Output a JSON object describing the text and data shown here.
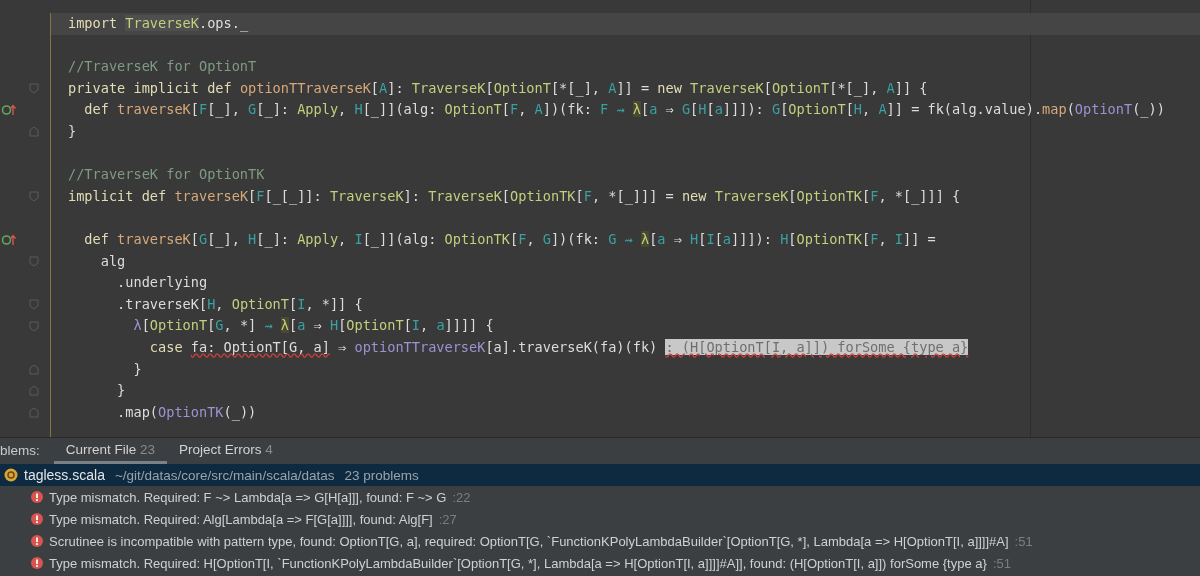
{
  "editor": {
    "lines": [
      {
        "kind": "current",
        "overrides": false,
        "fold_open": false,
        "fold_close": false,
        "tokens": [
          {
            "kind": "kw",
            "text": "import "
          },
          {
            "kind": "type_hl",
            "text": "TraverseK"
          },
          {
            "kind": "plain",
            "text": ".ops._"
          }
        ]
      },
      {
        "kind": "blank",
        "overrides": false,
        "fold_open": false,
        "fold_close": false
      },
      {
        "kind": "code",
        "overrides": false,
        "fold_open": false,
        "fold_close": false,
        "tokens": [
          {
            "kind": "comment",
            "text": "//TraverseK for OptionT"
          }
        ]
      },
      {
        "kind": "code",
        "overrides": false,
        "fold_open": true,
        "fold_close": false,
        "tokens": [
          {
            "kind": "kw",
            "text": "private implicit def "
          },
          {
            "kind": "fn",
            "text": "optionTTraverseK"
          },
          {
            "kind": "plain",
            "text": "["
          },
          {
            "kind": "tp",
            "text": "A"
          },
          {
            "kind": "plain",
            "text": "]: "
          },
          {
            "kind": "type",
            "text": "TraverseK"
          },
          {
            "kind": "plain",
            "text": "["
          },
          {
            "kind": "type",
            "text": "OptionT"
          },
          {
            "kind": "plain",
            "text": "[*[_], "
          },
          {
            "kind": "tp",
            "text": "A"
          },
          {
            "kind": "plain",
            "text": "]] = "
          },
          {
            "kind": "kw",
            "text": "new "
          },
          {
            "kind": "type",
            "text": "TraverseK"
          },
          {
            "kind": "plain",
            "text": "["
          },
          {
            "kind": "type",
            "text": "OptionT"
          },
          {
            "kind": "plain",
            "text": "[*[_], "
          },
          {
            "kind": "tp",
            "text": "A"
          },
          {
            "kind": "plain",
            "text": "]] {"
          }
        ]
      },
      {
        "kind": "code",
        "overrides": true,
        "fold_open": false,
        "fold_close": false,
        "tokens": [
          {
            "kind": "kw",
            "text": "  def "
          },
          {
            "kind": "fn",
            "text": "traverseK"
          },
          {
            "kind": "plain",
            "text": "["
          },
          {
            "kind": "tp",
            "text": "F"
          },
          {
            "kind": "plain",
            "text": "[_], "
          },
          {
            "kind": "tp",
            "text": "G"
          },
          {
            "kind": "plain",
            "text": "[_]: "
          },
          {
            "kind": "type",
            "text": "Apply"
          },
          {
            "kind": "plain",
            "text": ", "
          },
          {
            "kind": "tp",
            "text": "H"
          },
          {
            "kind": "plain",
            "text": "[_]](alg: "
          },
          {
            "kind": "type",
            "text": "OptionT"
          },
          {
            "kind": "plain",
            "text": "["
          },
          {
            "kind": "tp",
            "text": "F"
          },
          {
            "kind": "plain",
            "text": ", "
          },
          {
            "kind": "tp",
            "text": "A"
          },
          {
            "kind": "plain",
            "text": "])(fk: "
          },
          {
            "kind": "tp",
            "text": "F ⇝ "
          },
          {
            "kind": "lam",
            "text": "λ"
          },
          {
            "kind": "plain",
            "text": "["
          },
          {
            "kind": "tp",
            "text": "a"
          },
          {
            "kind": "plain",
            "text": " ⇒ "
          },
          {
            "kind": "tp",
            "text": "G"
          },
          {
            "kind": "plain",
            "text": "["
          },
          {
            "kind": "tp",
            "text": "H"
          },
          {
            "kind": "plain",
            "text": "["
          },
          {
            "kind": "tp",
            "text": "a"
          },
          {
            "kind": "plain",
            "text": "]]]): "
          },
          {
            "kind": "tp",
            "text": "G"
          },
          {
            "kind": "plain",
            "text": "["
          },
          {
            "kind": "type",
            "text": "OptionT"
          },
          {
            "kind": "plain",
            "text": "["
          },
          {
            "kind": "tp",
            "text": "H"
          },
          {
            "kind": "plain",
            "text": ", "
          },
          {
            "kind": "tp",
            "text": "A"
          },
          {
            "kind": "plain",
            "text": "]] = fk(alg.value)."
          },
          {
            "kind": "meth",
            "text": "map"
          },
          {
            "kind": "plain",
            "text": "("
          },
          {
            "kind": "call",
            "text": "OptionT"
          },
          {
            "kind": "plain",
            "text": "(_))"
          }
        ]
      },
      {
        "kind": "code",
        "overrides": false,
        "fold_open": false,
        "fold_close": true,
        "tokens": [
          {
            "kind": "plain",
            "text": "}"
          }
        ]
      },
      {
        "kind": "blank",
        "overrides": false,
        "fold_open": false,
        "fold_close": false
      },
      {
        "kind": "code",
        "overrides": false,
        "fold_open": false,
        "fold_close": false,
        "tokens": [
          {
            "kind": "comment",
            "text": "//TraverseK for OptionTK"
          }
        ]
      },
      {
        "kind": "code",
        "overrides": false,
        "fold_open": true,
        "fold_close": false,
        "tokens": [
          {
            "kind": "kw",
            "text": "implicit def "
          },
          {
            "kind": "fn",
            "text": "traverseK"
          },
          {
            "kind": "plain",
            "text": "["
          },
          {
            "kind": "tp",
            "text": "F"
          },
          {
            "kind": "plain",
            "text": "[_[_]]: "
          },
          {
            "kind": "type",
            "text": "TraverseK"
          },
          {
            "kind": "plain",
            "text": "]: "
          },
          {
            "kind": "type",
            "text": "TraverseK"
          },
          {
            "kind": "plain",
            "text": "["
          },
          {
            "kind": "type",
            "text": "OptionTK"
          },
          {
            "kind": "plain",
            "text": "["
          },
          {
            "kind": "tp",
            "text": "F"
          },
          {
            "kind": "plain",
            "text": ", *[_]]] = "
          },
          {
            "kind": "kw",
            "text": "new "
          },
          {
            "kind": "type",
            "text": "TraverseK"
          },
          {
            "kind": "plain",
            "text": "["
          },
          {
            "kind": "type",
            "text": "OptionTK"
          },
          {
            "kind": "plain",
            "text": "["
          },
          {
            "kind": "tp",
            "text": "F"
          },
          {
            "kind": "plain",
            "text": ", *[_]]] {"
          }
        ]
      },
      {
        "kind": "blank",
        "overrides": false,
        "fold_open": false,
        "fold_close": false
      },
      {
        "kind": "code",
        "overrides": true,
        "fold_open": false,
        "fold_close": false,
        "tokens": [
          {
            "kind": "kw",
            "text": "  def "
          },
          {
            "kind": "fn",
            "text": "traverseK"
          },
          {
            "kind": "plain",
            "text": "["
          },
          {
            "kind": "tp",
            "text": "G"
          },
          {
            "kind": "plain",
            "text": "[_], "
          },
          {
            "kind": "tp",
            "text": "H"
          },
          {
            "kind": "plain",
            "text": "[_]: "
          },
          {
            "kind": "type",
            "text": "Apply"
          },
          {
            "kind": "plain",
            "text": ", "
          },
          {
            "kind": "tp",
            "text": "I"
          },
          {
            "kind": "plain",
            "text": "[_]](alg: "
          },
          {
            "kind": "type",
            "text": "OptionTK"
          },
          {
            "kind": "plain",
            "text": "["
          },
          {
            "kind": "tp",
            "text": "F"
          },
          {
            "kind": "plain",
            "text": ", "
          },
          {
            "kind": "tp",
            "text": "G"
          },
          {
            "kind": "plain",
            "text": "])(fk: "
          },
          {
            "kind": "tp",
            "text": "G ⇝ "
          },
          {
            "kind": "lam",
            "text": "λ"
          },
          {
            "kind": "plain",
            "text": "["
          },
          {
            "kind": "tp",
            "text": "a"
          },
          {
            "kind": "plain",
            "text": " ⇒ "
          },
          {
            "kind": "tp",
            "text": "H"
          },
          {
            "kind": "plain",
            "text": "["
          },
          {
            "kind": "tp",
            "text": "I"
          },
          {
            "kind": "plain",
            "text": "["
          },
          {
            "kind": "tp",
            "text": "a"
          },
          {
            "kind": "plain",
            "text": "]]]): "
          },
          {
            "kind": "tp",
            "text": "H"
          },
          {
            "kind": "plain",
            "text": "["
          },
          {
            "kind": "type",
            "text": "OptionTK"
          },
          {
            "kind": "plain",
            "text": "["
          },
          {
            "kind": "tp",
            "text": "F"
          },
          {
            "kind": "plain",
            "text": ", "
          },
          {
            "kind": "tp",
            "text": "I"
          },
          {
            "kind": "plain",
            "text": "]] ="
          }
        ]
      },
      {
        "kind": "code",
        "overrides": false,
        "fold_open": true,
        "fold_close": false,
        "tokens": [
          {
            "kind": "plain",
            "text": "    alg"
          }
        ]
      },
      {
        "kind": "code",
        "overrides": false,
        "fold_open": false,
        "fold_close": false,
        "tokens": [
          {
            "kind": "plain",
            "text": "      .underlying"
          }
        ]
      },
      {
        "kind": "code",
        "overrides": false,
        "fold_open": true,
        "fold_close": false,
        "tokens": [
          {
            "kind": "plain",
            "text": "      .traverseK["
          },
          {
            "kind": "tp",
            "text": "H"
          },
          {
            "kind": "plain",
            "text": ", "
          },
          {
            "kind": "type",
            "text": "OptionT"
          },
          {
            "kind": "plain",
            "text": "["
          },
          {
            "kind": "tp",
            "text": "I"
          },
          {
            "kind": "plain",
            "text": ", *]] {"
          }
        ]
      },
      {
        "kind": "code",
        "overrides": false,
        "fold_open": true,
        "fold_close": false,
        "tokens": [
          {
            "kind": "call",
            "text": "        λ"
          },
          {
            "kind": "plain",
            "text": "["
          },
          {
            "kind": "type",
            "text": "OptionT"
          },
          {
            "kind": "plain",
            "text": "["
          },
          {
            "kind": "tp",
            "text": "G"
          },
          {
            "kind": "plain",
            "text": ", *] "
          },
          {
            "kind": "tp",
            "text": "⇝ "
          },
          {
            "kind": "lam",
            "text": "λ"
          },
          {
            "kind": "plain",
            "text": "["
          },
          {
            "kind": "tp",
            "text": "a"
          },
          {
            "kind": "plain",
            "text": " ⇒ "
          },
          {
            "kind": "tp",
            "text": "H"
          },
          {
            "kind": "plain",
            "text": "["
          },
          {
            "kind": "type",
            "text": "OptionT"
          },
          {
            "kind": "plain",
            "text": "["
          },
          {
            "kind": "tp",
            "text": "I"
          },
          {
            "kind": "plain",
            "text": ", "
          },
          {
            "kind": "tp",
            "text": "a"
          },
          {
            "kind": "plain",
            "text": "]]]] {"
          }
        ]
      },
      {
        "kind": "code",
        "overrides": false,
        "fold_open": false,
        "fold_close": false,
        "tokens": [
          {
            "kind": "kw",
            "text": "          case "
          },
          {
            "kind": "error",
            "text": "fa: OptionT[G, a]"
          },
          {
            "kind": "plain",
            "text": " ⇒ "
          },
          {
            "kind": "call",
            "text": "optionTTraverseK"
          },
          {
            "kind": "plain",
            "text": "[a].traverseK(fa)(fk) "
          },
          {
            "kind": "hint",
            "text": ": (H[OptionT[I, a]]) forSome {type a}"
          }
        ]
      },
      {
        "kind": "code",
        "overrides": false,
        "fold_open": false,
        "fold_close": true,
        "tokens": [
          {
            "kind": "plain",
            "text": "        }"
          }
        ]
      },
      {
        "kind": "code",
        "overrides": false,
        "fold_open": false,
        "fold_close": true,
        "tokens": [
          {
            "kind": "plain",
            "text": "      }"
          }
        ]
      },
      {
        "kind": "code",
        "overrides": false,
        "fold_open": false,
        "fold_close": true,
        "tokens": [
          {
            "kind": "plain",
            "text": "      .map("
          },
          {
            "kind": "call",
            "text": "OptionTK"
          },
          {
            "kind": "plain",
            "text": "(_))"
          }
        ]
      }
    ]
  },
  "problems": {
    "title": "blems:",
    "tabs": [
      {
        "label": "Current File",
        "count": "23",
        "selected": true
      },
      {
        "label": "Project Errors",
        "count": "4",
        "selected": false
      }
    ],
    "file": {
      "name": "tagless.scala",
      "path": "~/git/datas/core/src/main/scala/datas",
      "count": "23 problems",
      "selected": true
    },
    "issues": [
      {
        "kind": "error",
        "message": "Type mismatch. Required: F ~> Lambda[a => G[H[a]]], found: F ~> G",
        "line": ":22"
      },
      {
        "kind": "error",
        "message": "Type mismatch. Required: Alg[Lambda[a => F[G[a]]]], found: Alg[F]",
        "line": ":27"
      },
      {
        "kind": "error",
        "message": "Scrutinee is incompatible with pattern type, found: OptionT[G, a], required: OptionT[G, `FunctionKPolyLambdaBuilder`[OptionT[G, *], Lambda[a => H[OptionT[I, a]]]]#A]",
        "line": ":51"
      },
      {
        "kind": "error",
        "message": "Type mismatch. Required: H[OptionT[I, `FunctionKPolyLambdaBuilder`[OptionT[G, *], Lambda[a => H[OptionT[I, a]]]]#A]], found: (H[OptionT[I, a]]) forSome {type a}",
        "line": ":51"
      }
    ]
  }
}
